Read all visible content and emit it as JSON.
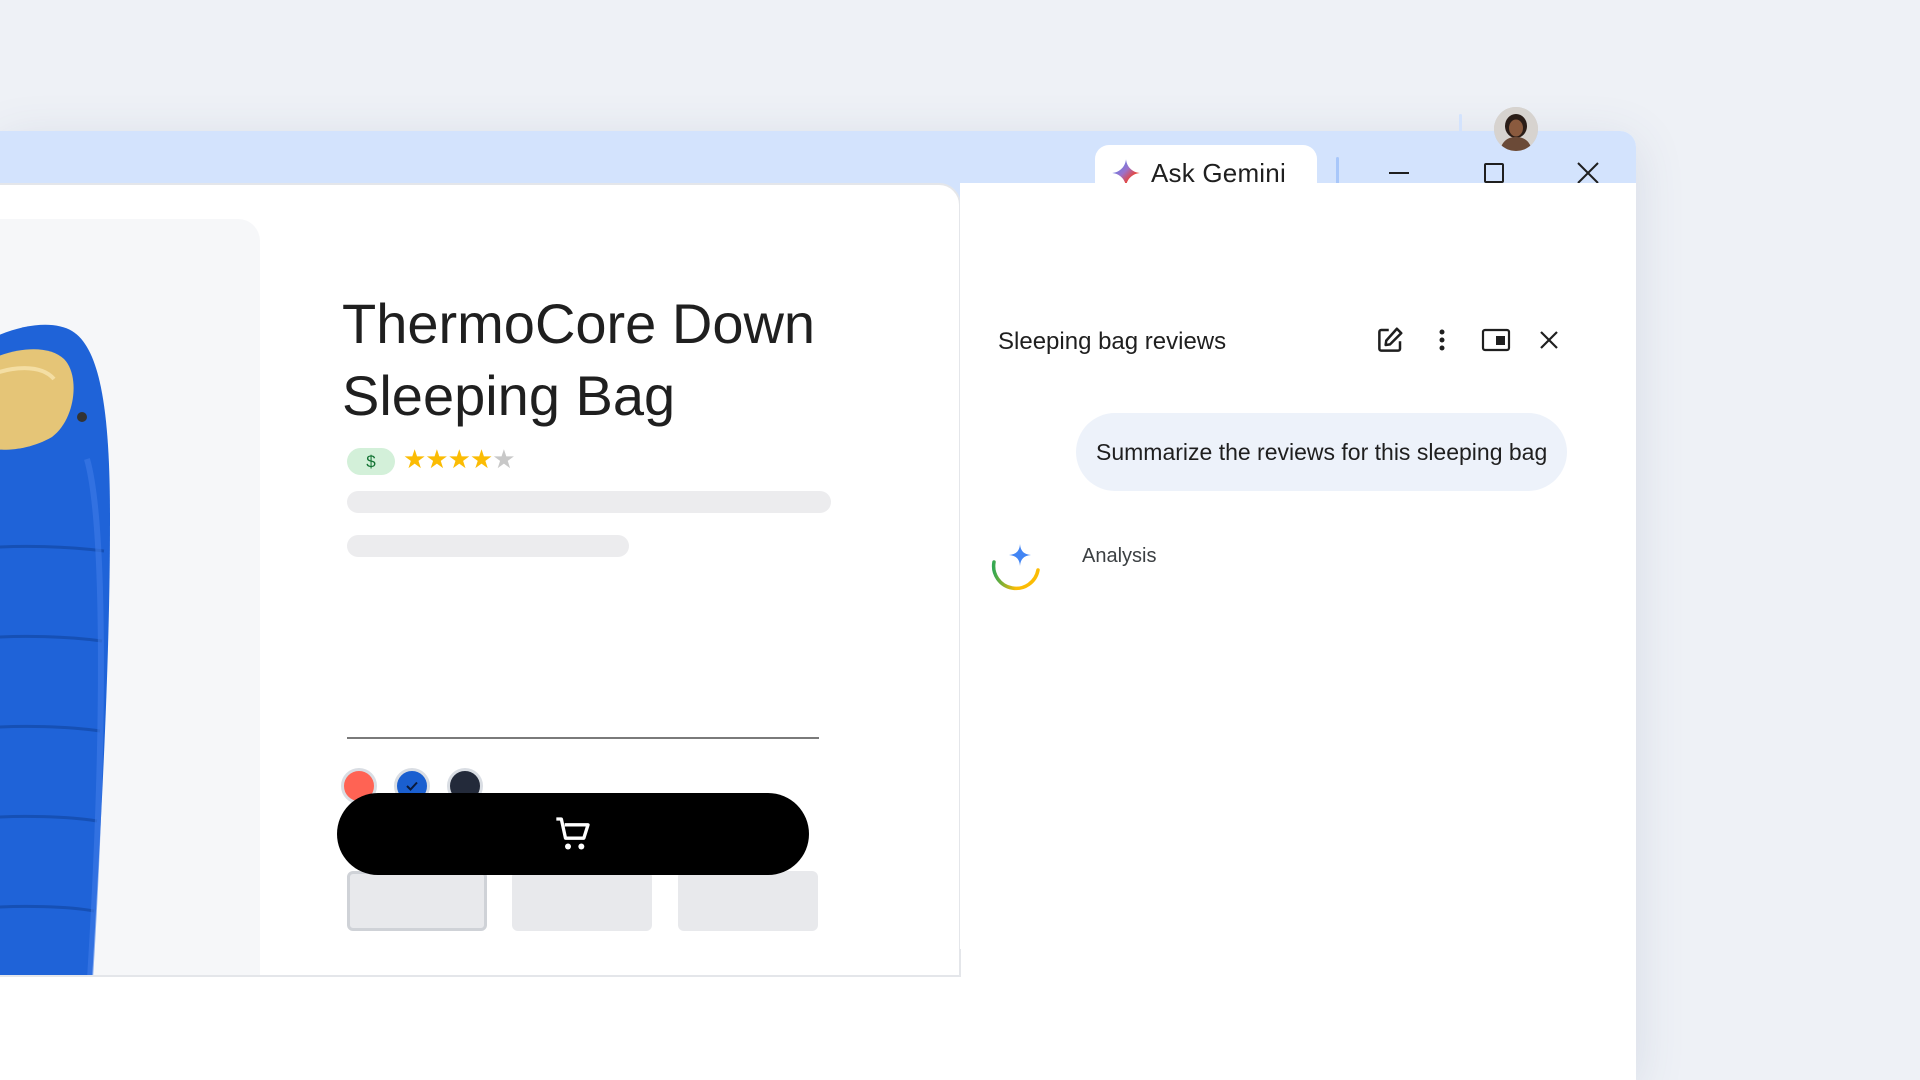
{
  "titlebar": {
    "ask_gemini_label": "Ask Gemini"
  },
  "toolbar": {
    "icons": [
      "star-icon",
      "extension-icon",
      "avatar",
      "more-vert-icon"
    ]
  },
  "product": {
    "title_line1": "ThermoCore Down",
    "title_line2": "Sleeping Bag",
    "price_badge": "$",
    "rating": 4,
    "rating_max": 5,
    "stars_filled": "★★★★",
    "stars_empty": "★",
    "colors": [
      {
        "name": "red",
        "hex": "#ff6354",
        "selected": false
      },
      {
        "name": "blue",
        "hex": "#1a5fd0",
        "selected": true
      },
      {
        "name": "navy",
        "hex": "#232a3a",
        "selected": false
      }
    ],
    "add_to_cart_icon": "cart-icon"
  },
  "panel": {
    "title": "Sleeping bag reviews",
    "user_message": "Summarize the reviews for this sleeping bag",
    "status": "Analysis"
  },
  "colors": {
    "titlebar_bg": "#d3e3fd",
    "omnibox_bg": "#edf2fa",
    "accent_blue": "#1a5fd0",
    "cart_button": "#000000"
  }
}
